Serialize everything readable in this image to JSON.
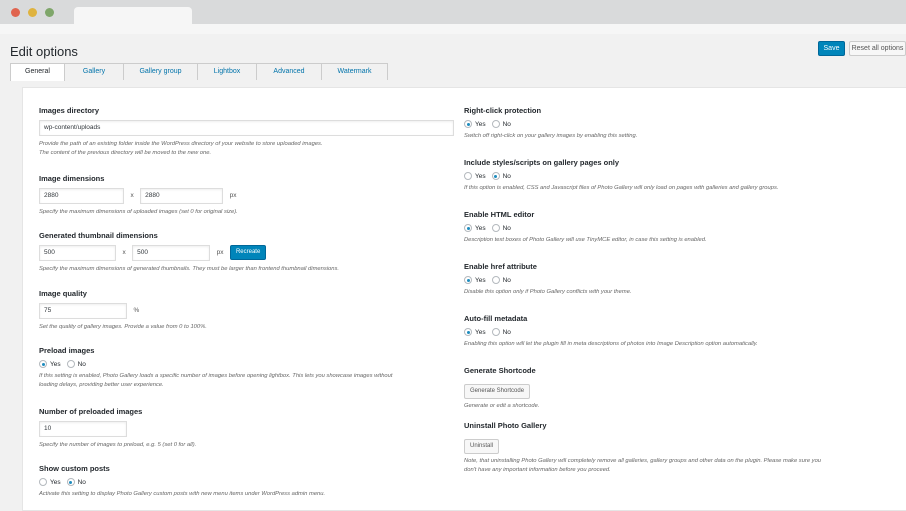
{
  "page": {
    "title": "Edit options",
    "save_label": "Save",
    "reset_label": "Reset all options"
  },
  "tabs": [
    {
      "label": "General"
    },
    {
      "label": "Gallery"
    },
    {
      "label": "Gallery group"
    },
    {
      "label": "Lightbox"
    },
    {
      "label": "Advanced"
    },
    {
      "label": "Watermark"
    }
  ],
  "left": {
    "images_directory": {
      "label": "Images directory",
      "value": "wp-content/uploads",
      "desc1": "Provide the path of an existing folder inside the WordPress directory of your website to store uploaded images.",
      "desc2": "The content of the previous directory will be moved to the new one."
    },
    "image_dimensions": {
      "label": "Image dimensions",
      "width": "2880",
      "height": "2880",
      "x": "x",
      "unit": "px",
      "desc": "Specify the maximum dimensions of uploaded images (set 0 for original size)."
    },
    "thumb_dimensions": {
      "label": "Generated thumbnail dimensions",
      "width": "500",
      "height": "500",
      "x": "x",
      "unit": "px",
      "recreate": "Recreate",
      "desc": "Specify the maximum dimensions of generated thumbnails. They must be larger than frontend thumbnail dimensions."
    },
    "image_quality": {
      "label": "Image quality",
      "value": "75",
      "unit": "%",
      "desc": "Set the quality of gallery images. Provide a value from 0 to 100%."
    },
    "preload_images": {
      "label": "Preload images",
      "yes": "Yes",
      "no": "No",
      "desc1": "If this setting is enabled, Photo Gallery loads a specific number of images before opening lightbox. This lets you showcase images without",
      "desc2": "loading delays, providing better user experience."
    },
    "preloaded_count": {
      "label": "Number of preloaded images",
      "value": "10",
      "desc": "Specify the number of images to preload, e.g. 5 (set 0 for all)."
    },
    "custom_posts": {
      "label": "Show custom posts",
      "yes": "Yes",
      "no": "No",
      "desc": "Activate this setting to display Photo Gallery custom posts with new menu items under WordPress admin menu."
    }
  },
  "right": {
    "right_click": {
      "label": "Right-click protection",
      "yes": "Yes",
      "no": "No",
      "desc": "Switch off right-click on your gallery images by enabling this setting."
    },
    "include_scripts": {
      "label": "Include styles/scripts on gallery pages only",
      "yes": "Yes",
      "no": "No",
      "desc": "If this option is enabled, CSS and Javascript files of Photo Gallery will only load on pages with galleries and gallery groups."
    },
    "html_editor": {
      "label": "Enable HTML editor",
      "yes": "Yes",
      "no": "No",
      "desc": "Description text boxes of Photo Gallery will use TinyMCE editor, in case this setting is enabled."
    },
    "href_attr": {
      "label": "Enable href attribute",
      "yes": "Yes",
      "no": "No",
      "desc": "Disable this option only if Photo Gallery conflicts with your theme."
    },
    "auto_fill": {
      "label": "Auto-fill metadata",
      "yes": "Yes",
      "no": "No",
      "desc": "Enabling this option will let the plugin fill in meta descriptions of photos into Image Description option automatically."
    },
    "shortcode": {
      "label": "Generate Shortcode",
      "button": "Generate Shortcode",
      "desc": "Generate or edit a shortcode."
    },
    "uninstall": {
      "label": "Uninstall Photo Gallery",
      "button": "Uninstall",
      "desc1": "Note, that uninstalling Photo Gallery will completely remove all galleries, gallery groups and other data on the plugin. Please make sure you",
      "desc2": "don't have any important information before you proceed."
    }
  },
  "radio_state": {
    "preload_images": "yes",
    "custom_posts": "no",
    "right_click": "yes",
    "include_scripts": "no",
    "html_editor": "yes",
    "href_attr": "yes",
    "auto_fill": "yes"
  },
  "colors": {
    "primary": "#0085ba",
    "link": "#0073aa",
    "background": "#f1f1f1"
  }
}
